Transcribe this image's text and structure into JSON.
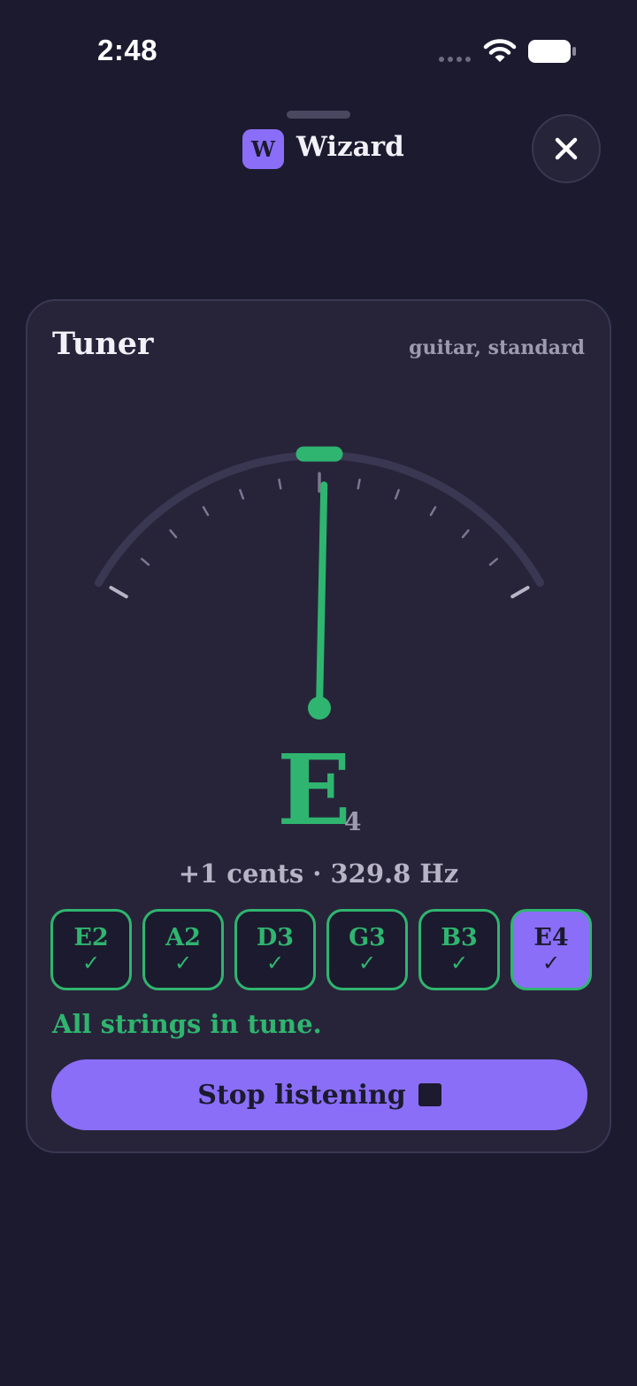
{
  "status_bar": {
    "time": "2:48",
    "icons": [
      "signal-dots-icon",
      "wifi-icon",
      "battery-icon"
    ]
  },
  "header": {
    "app_badge_letter": "W",
    "app_name": "Wizard",
    "close_icon": "close-icon"
  },
  "tuner": {
    "title": "Tuner",
    "tuning": "guitar, standard",
    "needle_cents": 1,
    "note_name": "E",
    "note_octave": "4",
    "reading": "+1 cents · 329.8 Hz",
    "strings": [
      {
        "label": "E2",
        "check": "✓",
        "in_tune": true,
        "active": false
      },
      {
        "label": "A2",
        "check": "✓",
        "in_tune": true,
        "active": false
      },
      {
        "label": "D3",
        "check": "✓",
        "in_tune": true,
        "active": false
      },
      {
        "label": "G3",
        "check": "✓",
        "in_tune": true,
        "active": false
      },
      {
        "label": "B3",
        "check": "✓",
        "in_tune": true,
        "active": false
      },
      {
        "label": "E4",
        "check": "✓",
        "in_tune": true,
        "active": true
      }
    ],
    "status_message": "All strings in tune.",
    "stop_button_label": "Stop listening",
    "stop_icon": "stop-icon"
  },
  "colors": {
    "background": "#1c1a2e",
    "card": "#27243a",
    "accent_green": "#2fb56f",
    "accent_purple": "#8a6ef8",
    "muted_text": "#9e9aae"
  }
}
